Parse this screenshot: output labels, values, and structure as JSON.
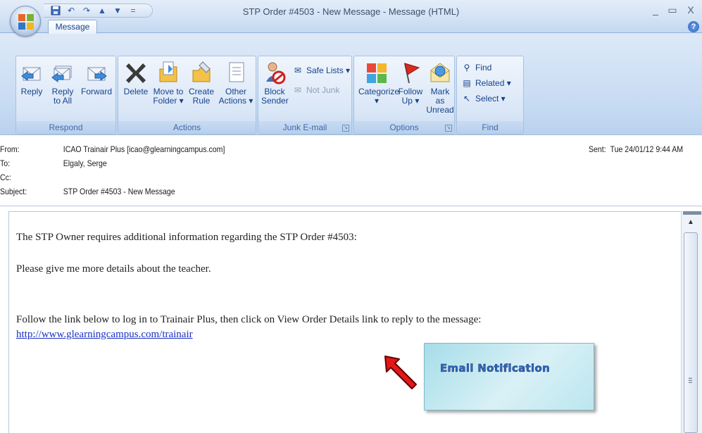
{
  "window": {
    "title": "STP Order #4503 - New Message - Message (HTML)",
    "minimize_glyph": "_",
    "maximize_glyph": "▭",
    "close_glyph": "X"
  },
  "quick_access": {
    "customize_glyph": "="
  },
  "ribbon": {
    "tab_message": "Message",
    "help_glyph": "?",
    "groups": {
      "respond": {
        "label": "Respond",
        "reply": "Reply",
        "reply_all": "Reply to All",
        "forward": "Forward"
      },
      "actions": {
        "label": "Actions",
        "delete": "Delete",
        "move_to_folder": "Move to Folder ▾",
        "create_rule": "Create Rule",
        "other_actions": "Other Actions ▾"
      },
      "junk": {
        "label": "Junk E-mail",
        "block_sender": "Block Sender",
        "safe_lists": "Safe Lists ▾",
        "not_junk": "Not Junk"
      },
      "options": {
        "label": "Options",
        "categorize": "Categorize ▾",
        "follow_up": "Follow Up ▾",
        "mark_as_unread": "Mark as Unread"
      },
      "find": {
        "label": "Find",
        "find": "Find",
        "related": "Related ▾",
        "select": "Select ▾"
      }
    }
  },
  "header": {
    "from_label": "From:",
    "from_value": "ICAO Trainair Plus [icao@glearningcampus.com]",
    "to_label": "To:",
    "to_value": "Elgaly, Serge",
    "cc_label": "Cc:",
    "cc_value": "",
    "subject_label": "Subject:",
    "subject_value": "STP Order #4503 - New Message",
    "sent_label": "Sent:",
    "sent_value": "Tue 24/01/12 9:44 AM"
  },
  "message": {
    "line1": "The STP Owner requires additional information regarding the STP Order #4503:",
    "line2": "Please give me more details about the teacher.",
    "line3": "Follow the link below to log in to Trainair Plus, then click on View Order Details link to reply to the message:",
    "link": "http://www.glearningcampus.com/trainair"
  },
  "callout": {
    "text": "Email Notification"
  },
  "colors": {
    "ribbon_text": "#15428b",
    "link": "#1a31c4",
    "arrow": "#e21818",
    "callout_fill": "#bce6ef"
  }
}
